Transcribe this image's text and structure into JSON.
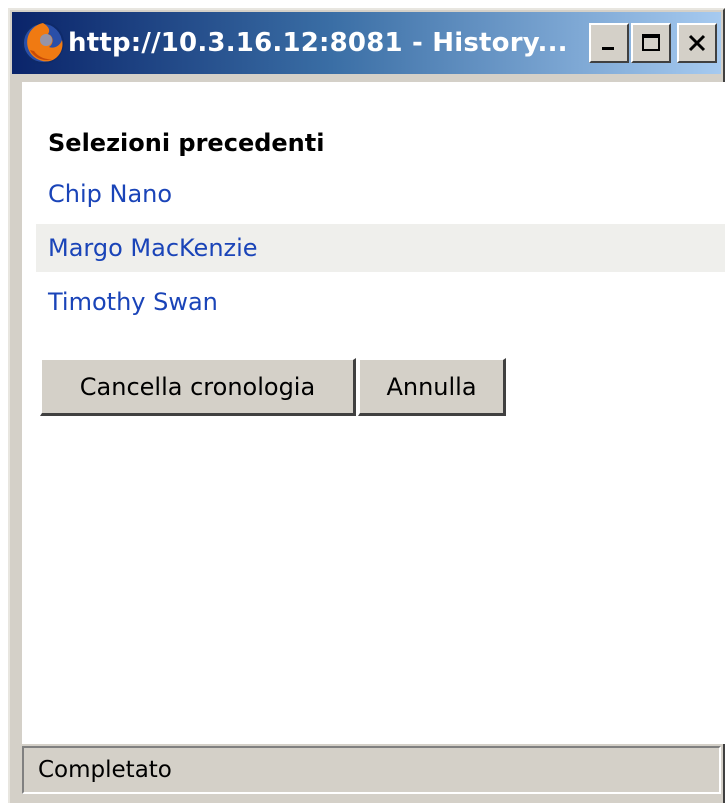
{
  "window": {
    "title": "http://10.3.16.12:8081 - History...",
    "app_icon": "firefox-icon",
    "controls": {
      "minimize_icon": "minimize-icon",
      "maximize_icon": "maximize-icon",
      "close_icon": "close-icon"
    }
  },
  "history": {
    "heading": "Selezioni precedenti",
    "items": [
      {
        "label": "Chip Nano",
        "highlighted": false
      },
      {
        "label": "Margo MacKenzie",
        "highlighted": true
      },
      {
        "label": "Timothy Swan",
        "highlighted": false
      }
    ]
  },
  "actions": {
    "clear_label": "Cancella cronologia",
    "cancel_label": "Annulla"
  },
  "statusbar": {
    "text": "Completato"
  },
  "colors": {
    "titlebar_start": "#0a246a",
    "titlebar_end": "#a6caf0",
    "link": "#1a44b8",
    "highlight_row": "#efefec",
    "chrome": "#d4d0c8"
  }
}
